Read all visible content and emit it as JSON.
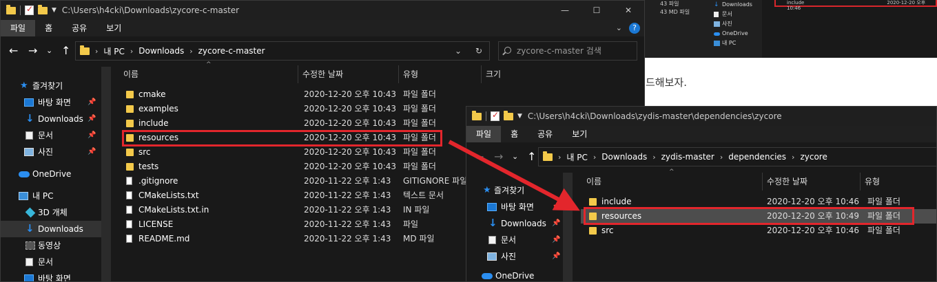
{
  "background": {
    "doc_text": "드해보자.",
    "mini_list": [
      "43  파일",
      "43  MD 파일"
    ],
    "mini_nav": [
      "Downloads",
      "문서",
      "사진",
      "OneDrive",
      "내 PC"
    ],
    "mini_red_label": "include",
    "mini_red_date": "2020-12-20 오후 10:46"
  },
  "window1": {
    "title": "C:\\Users\\h4cki\\Downloads\\zycore-c-master",
    "controls": {
      "minimize": "—",
      "maximize": "☐",
      "close": "✕"
    },
    "ribbon_tabs": [
      "파일",
      "홈",
      "공유",
      "보기"
    ],
    "ribbon_tools": {
      "expand": "⌄"
    },
    "nav": {
      "back": "←",
      "forward": "→",
      "recent": "⌄",
      "up": "↑"
    },
    "breadcrumb": [
      "내 PC",
      "Downloads",
      "zycore-c-master"
    ],
    "address_dropdown": "⌄",
    "refresh": "↻",
    "search_placeholder": "zycore-c-master 검색",
    "columns": [
      "이름",
      "수정한 날짜",
      "유형",
      "크기"
    ],
    "sort_caret": "^",
    "sidebar": [
      {
        "label": "즐겨찾기",
        "icon": "star-icon",
        "pin": false
      },
      {
        "label": "바탕 화면",
        "icon": "desktop-icon",
        "pin": true
      },
      {
        "label": "Downloads",
        "icon": "download-icon",
        "pin": true
      },
      {
        "label": "문서",
        "icon": "document-icon",
        "pin": true
      },
      {
        "label": "사진",
        "icon": "picture-icon",
        "pin": true
      },
      {
        "label": "OneDrive",
        "icon": "cloud-icon",
        "pin": false
      },
      {
        "label": "내 PC",
        "icon": "pc-icon",
        "pin": false
      },
      {
        "label": "3D 개체",
        "icon": "cube-icon",
        "pin": false
      },
      {
        "label": "Downloads",
        "icon": "download-icon",
        "pin": false,
        "selected": true
      },
      {
        "label": "동영상",
        "icon": "video-icon",
        "pin": false
      },
      {
        "label": "문서",
        "icon": "document-icon",
        "pin": false
      },
      {
        "label": "바탕 화면",
        "icon": "desktop-icon",
        "pin": false
      }
    ],
    "pin_glyph": "📌",
    "files": [
      {
        "name": "cmake",
        "date": "2020-12-20 오후 10:43",
        "type": "파일 폴더",
        "kind": "folder"
      },
      {
        "name": "examples",
        "date": "2020-12-20 오후 10:43",
        "type": "파일 폴더",
        "kind": "folder"
      },
      {
        "name": "include",
        "date": "2020-12-20 오후 10:43",
        "type": "파일 폴더",
        "kind": "folder"
      },
      {
        "name": "resources",
        "date": "2020-12-20 오후 10:43",
        "type": "파일 폴더",
        "kind": "folder",
        "highlight": true
      },
      {
        "name": "src",
        "date": "2020-12-20 오후 10:43",
        "type": "파일 폴더",
        "kind": "folder"
      },
      {
        "name": "tests",
        "date": "2020-12-20 오후 10:43",
        "type": "파일 폴더",
        "kind": "folder"
      },
      {
        "name": ".gitignore",
        "date": "2020-11-22 오후 1:43",
        "type": "GITIGNORE 파일",
        "kind": "file"
      },
      {
        "name": "CMakeLists.txt",
        "date": "2020-11-22 오후 1:43",
        "type": "텍스트 문서",
        "kind": "file"
      },
      {
        "name": "CMakeLists.txt.in",
        "date": "2020-11-22 오후 1:43",
        "type": "IN 파일",
        "kind": "file"
      },
      {
        "name": "LICENSE",
        "date": "2020-11-22 오후 1:43",
        "type": "파일",
        "kind": "file"
      },
      {
        "name": "README.md",
        "date": "2020-11-22 오후 1:43",
        "type": "MD 파일",
        "kind": "file"
      }
    ]
  },
  "window2": {
    "title": "C:\\Users\\h4cki\\Downloads\\zydis-master\\dependencies\\zycore",
    "ribbon_tabs": [
      "파일",
      "홈",
      "공유",
      "보기"
    ],
    "nav": {
      "back": "←",
      "forward": "→",
      "recent": "⌄",
      "up": "↑"
    },
    "breadcrumb": [
      "내 PC",
      "Downloads",
      "zydis-master",
      "dependencies",
      "zycore"
    ],
    "columns": [
      "이름",
      "수정한 날짜",
      "유형"
    ],
    "sort_caret": "^",
    "sidebar": [
      {
        "label": "즐겨찾기",
        "icon": "star-icon",
        "pin": false
      },
      {
        "label": "바탕 화면",
        "icon": "desktop-icon",
        "pin": true
      },
      {
        "label": "Downloads",
        "icon": "download-icon",
        "pin": true
      },
      {
        "label": "문서",
        "icon": "document-icon",
        "pin": true
      },
      {
        "label": "사진",
        "icon": "picture-icon",
        "pin": true
      },
      {
        "label": "OneDrive",
        "icon": "cloud-icon",
        "pin": false
      }
    ],
    "pin_glyph": "📌",
    "files": [
      {
        "name": "include",
        "date": "2020-12-20 오후 10:46",
        "type": "파일 폴더",
        "kind": "folder"
      },
      {
        "name": "resources",
        "date": "2020-12-20 오후 10:49",
        "type": "파일 폴더",
        "kind": "folder",
        "highlight": true
      },
      {
        "name": "src",
        "date": "2020-12-20 오후 10:46",
        "type": "파일 폴더",
        "kind": "folder"
      }
    ]
  },
  "colors": {
    "accent_red": "#e3262c",
    "folder": "#f3c94a",
    "window_bg": "#191919"
  }
}
